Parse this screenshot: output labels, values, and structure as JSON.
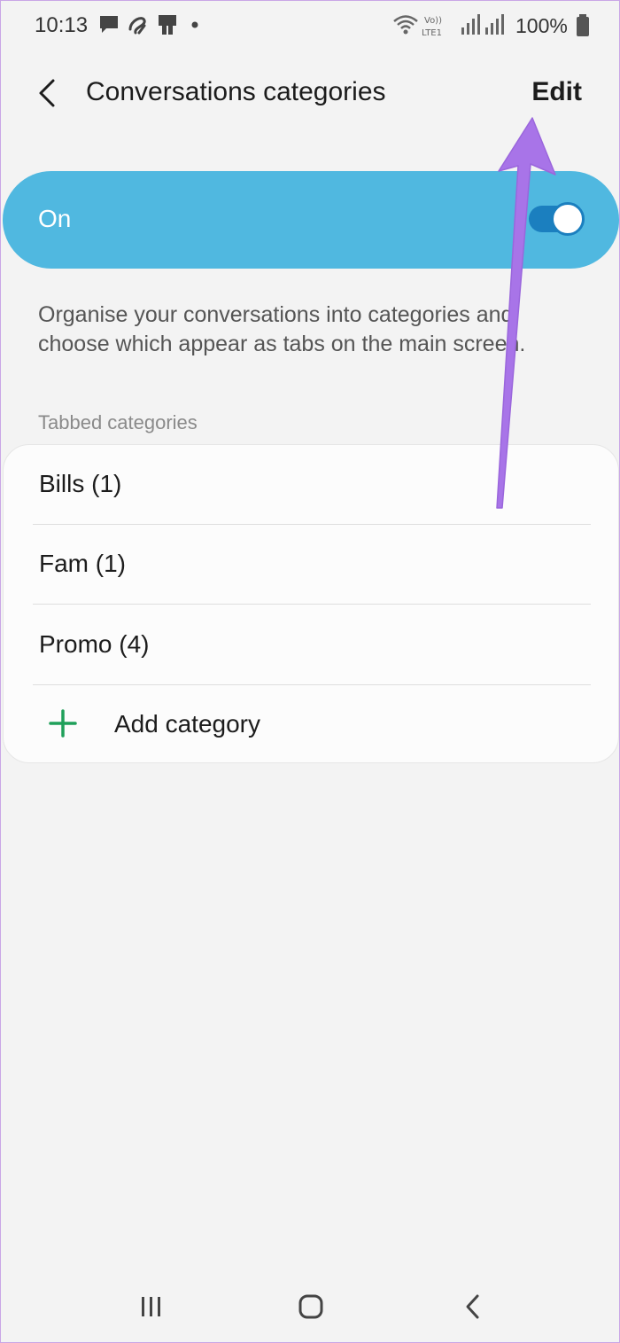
{
  "status_bar": {
    "time": "10:13",
    "battery": "100%",
    "left_icons": [
      "message-icon",
      "airtel-icon",
      "sim-card-icon",
      "dot-icon"
    ],
    "right_icons": [
      "wifi-icon",
      "volte-icon",
      "signal-icon",
      "signal-icon",
      "battery-icon"
    ]
  },
  "header": {
    "title": "Conversations categories",
    "edit_label": "Edit"
  },
  "master_switch": {
    "label": "On",
    "checked": true,
    "color": "#50b8e0"
  },
  "description": "Organise your conversations into categories and choose which appear as tabs on the main screen.",
  "section_header": "Tabbed categories",
  "categories": [
    {
      "label": "Bills (1)"
    },
    {
      "label": "Fam (1)"
    },
    {
      "label": "Promo (4)"
    }
  ],
  "add_category_label": "Add category",
  "accent_green": "#1fa05a",
  "annotation_color": "#a874e8",
  "nav_bar": [
    "recent-apps-icon",
    "home-icon",
    "back-icon"
  ]
}
